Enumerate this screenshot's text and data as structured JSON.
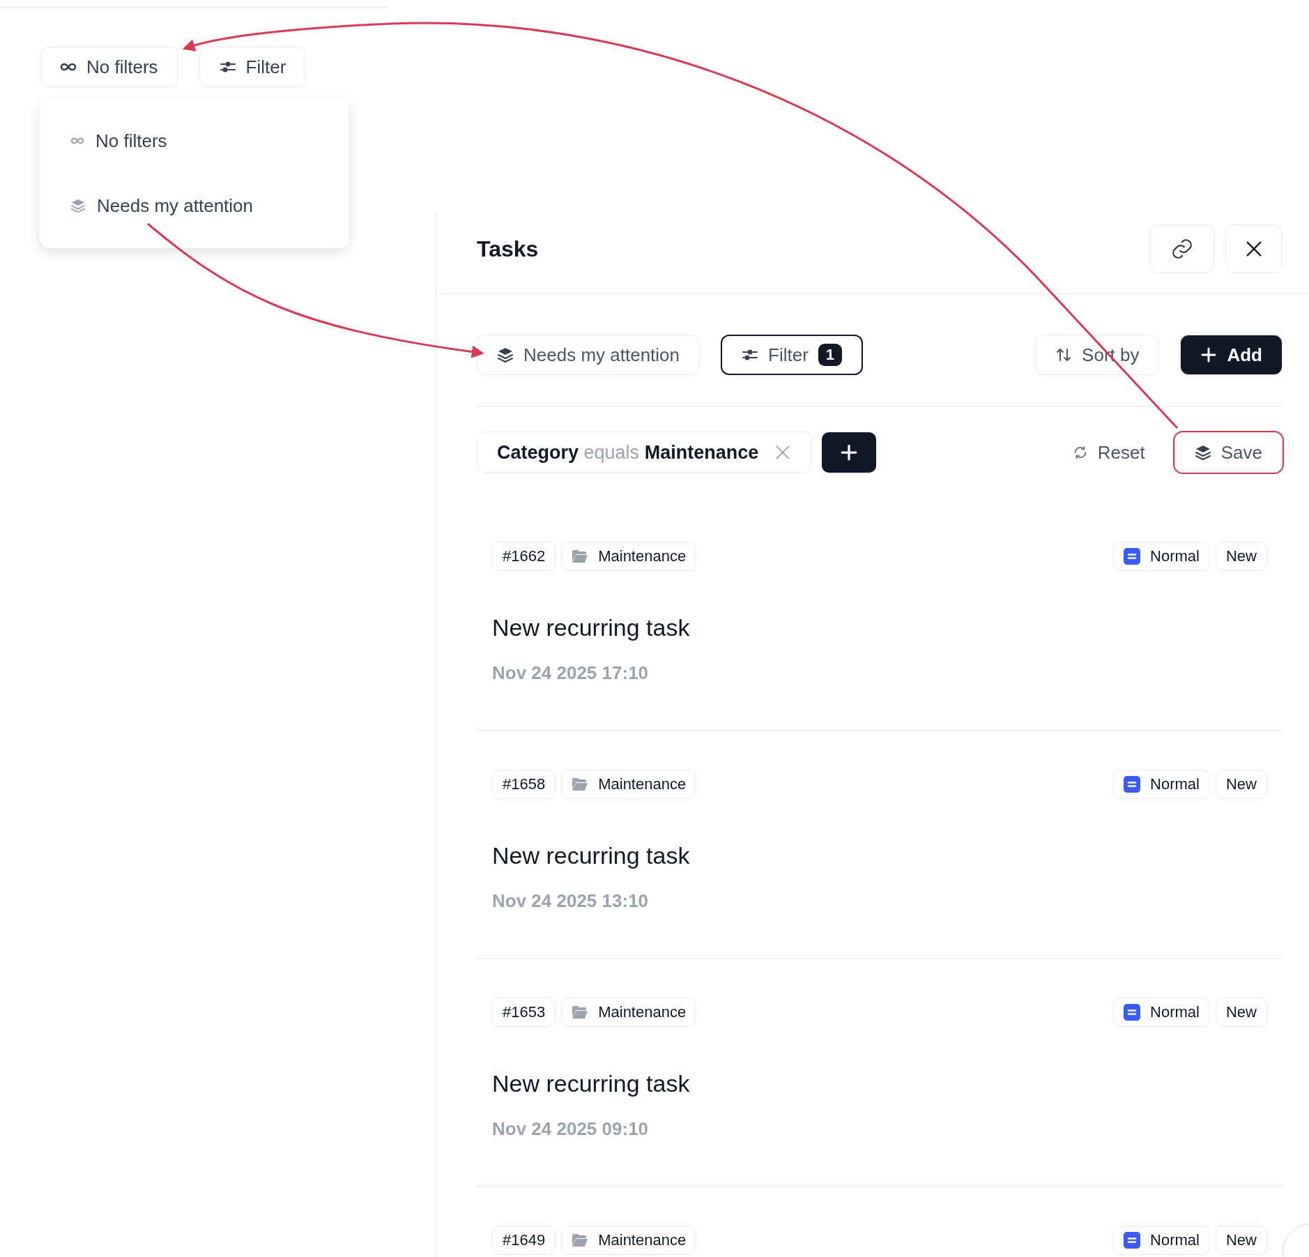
{
  "view_menu": {
    "button": {
      "label": "No filters"
    },
    "filter_button": {
      "label": "Filter"
    },
    "options": [
      {
        "label": "No filters",
        "kind": "infinity"
      },
      {
        "label": "Needs my attention",
        "kind": "layers"
      }
    ]
  },
  "panel": {
    "title": "Tasks",
    "view": {
      "label": "Needs my attention"
    },
    "filter": {
      "label": "Filter",
      "count": "1"
    },
    "sort": {
      "label": "Sort by"
    },
    "add": {
      "label": "Add"
    },
    "active_filter": {
      "field": "Category",
      "operator": "equals",
      "value": "Maintenance"
    },
    "reset": {
      "label": "Reset"
    },
    "save": {
      "label": "Save"
    },
    "tasks": [
      {
        "id": "#1662",
        "category": "Maintenance",
        "priority": "Normal",
        "status": "New",
        "title": "New recurring task",
        "date": "Nov 24 2025 17:10"
      },
      {
        "id": "#1658",
        "category": "Maintenance",
        "priority": "Normal",
        "status": "New",
        "title": "New recurring task",
        "date": "Nov 24 2025 13:10"
      },
      {
        "id": "#1653",
        "category": "Maintenance",
        "priority": "Normal",
        "status": "New",
        "title": "New recurring task",
        "date": "Nov 24 2025 09:10"
      },
      {
        "id": "#1649",
        "category": "Maintenance",
        "priority": "Normal",
        "status": "New"
      }
    ]
  }
}
